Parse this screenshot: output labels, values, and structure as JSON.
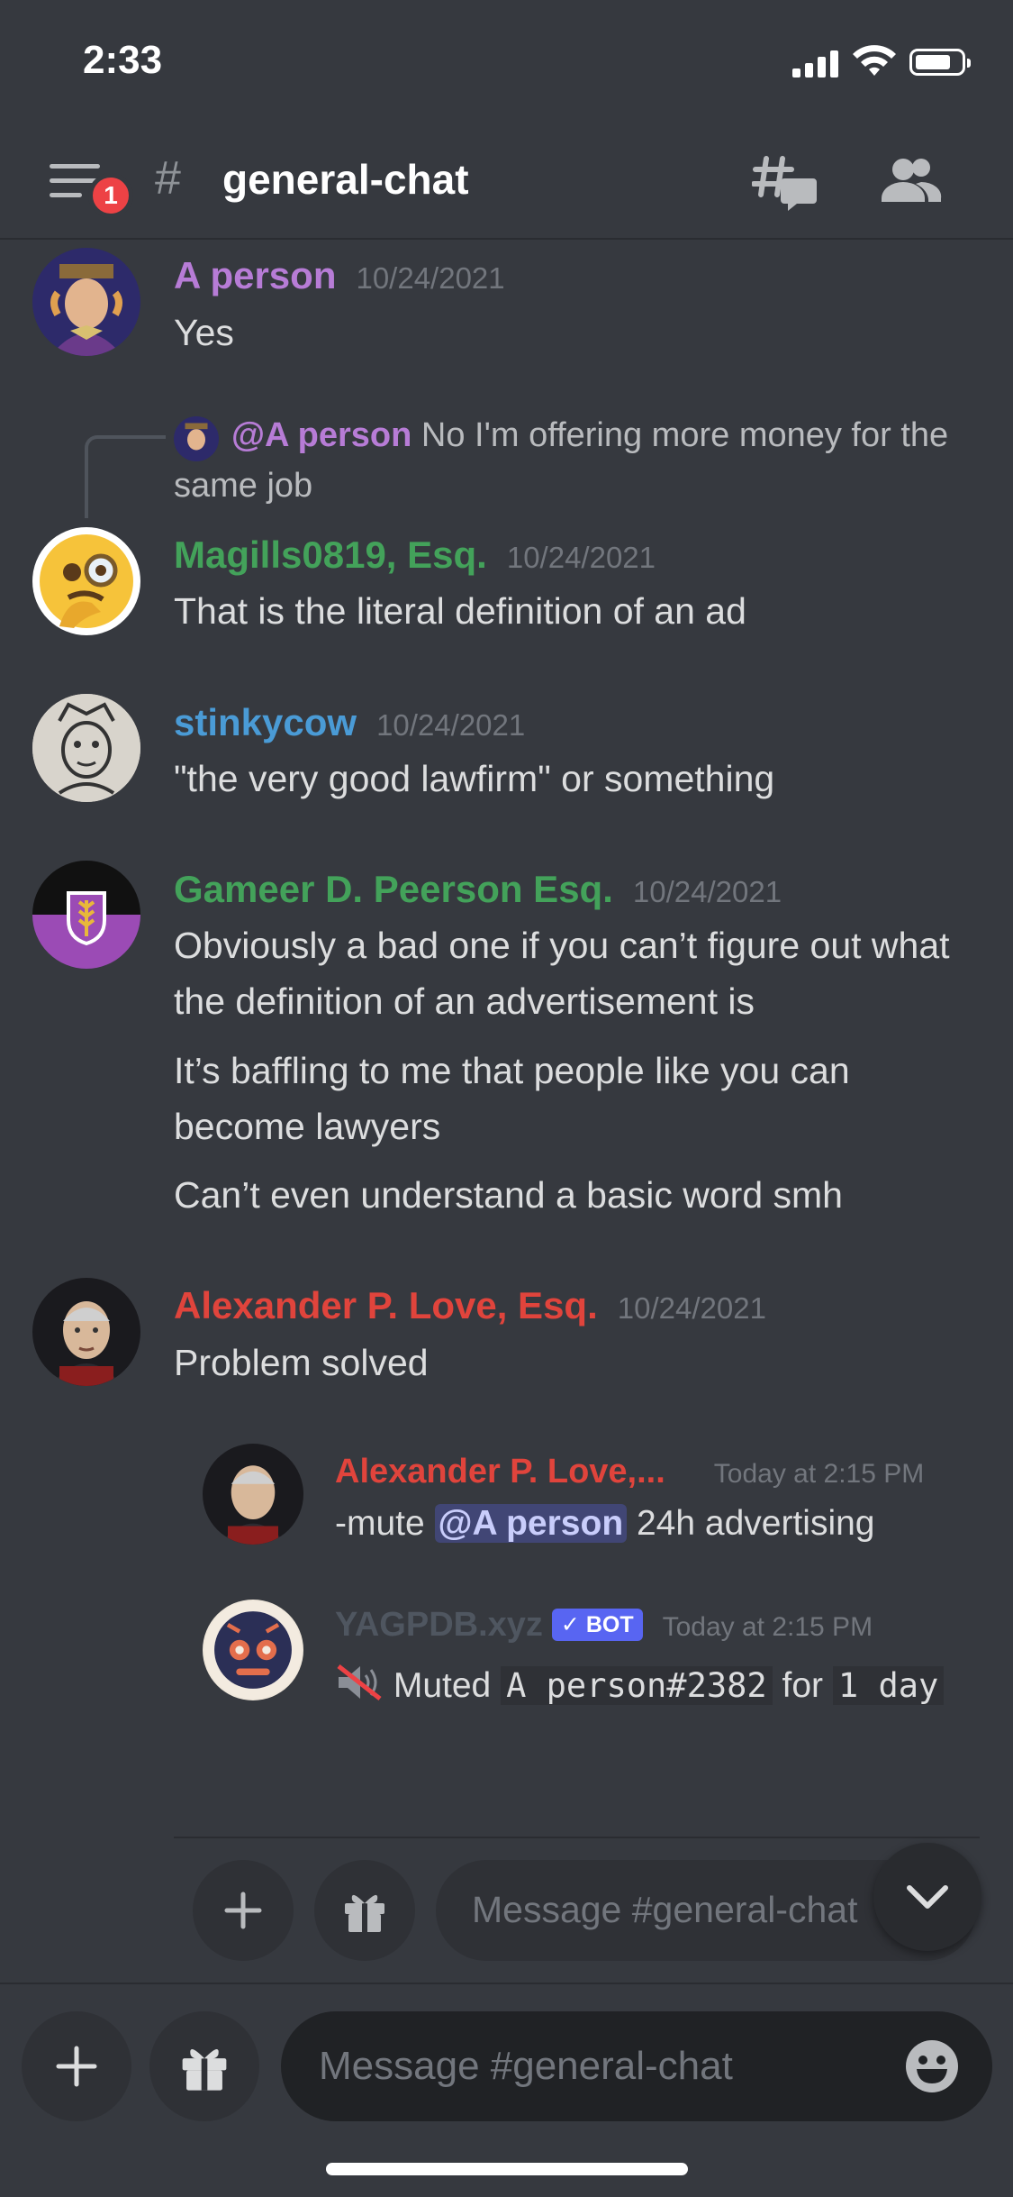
{
  "status_bar": {
    "time": "2:33"
  },
  "header": {
    "unread_count": "1",
    "hash": "#",
    "channel_name": "general-chat"
  },
  "messages": [
    {
      "username": "A person",
      "timestamp": "10/24/2021",
      "name_color": "#b77cd6",
      "lines": [
        "Yes"
      ]
    },
    {
      "reply": {
        "mention": "@A person",
        "text": "No I'm offering more money for the same job"
      },
      "username": "Magills0819, Esq.",
      "timestamp": "10/24/2021",
      "name_color": "#43a25a",
      "lines": [
        "That is the literal definition of an ad"
      ]
    },
    {
      "username": "stinkycow",
      "timestamp": "10/24/2021",
      "name_color": "#4a9bd6",
      "lines": [
        "\"the very good lawfirm\" or something"
      ]
    },
    {
      "username": "Gameer D. Peerson Esq.",
      "timestamp": "10/24/2021",
      "name_color": "#43a25a",
      "lines": [
        "Obviously a bad one if you can’t figure out what the definition of an advertisement is",
        "It’s baffling to me that people like you can become lawyers",
        "Can’t even understand a basic word smh"
      ]
    },
    {
      "username": "Alexander P. Love, Esq.",
      "timestamp": "10/24/2021",
      "name_color": "#e0443c",
      "lines": [
        "Problem solved"
      ]
    }
  ],
  "embedded": {
    "message1": {
      "username": "Alexander P. Love,...",
      "timestamp": "Today at 2:15 PM",
      "prefix": "-mute ",
      "mention": "@A person",
      "suffix": " 24h advertising"
    },
    "message2": {
      "username": "YAGPDB.xyz",
      "bot_tag": "✓ BOT",
      "timestamp": "Today at 2:15 PM",
      "muted": "Muted",
      "code1": "A person#2382",
      "for": "for",
      "code2": "1 day"
    },
    "input_placeholder": "Message #general-chat"
  },
  "composer": {
    "placeholder": "Message #general-chat"
  }
}
